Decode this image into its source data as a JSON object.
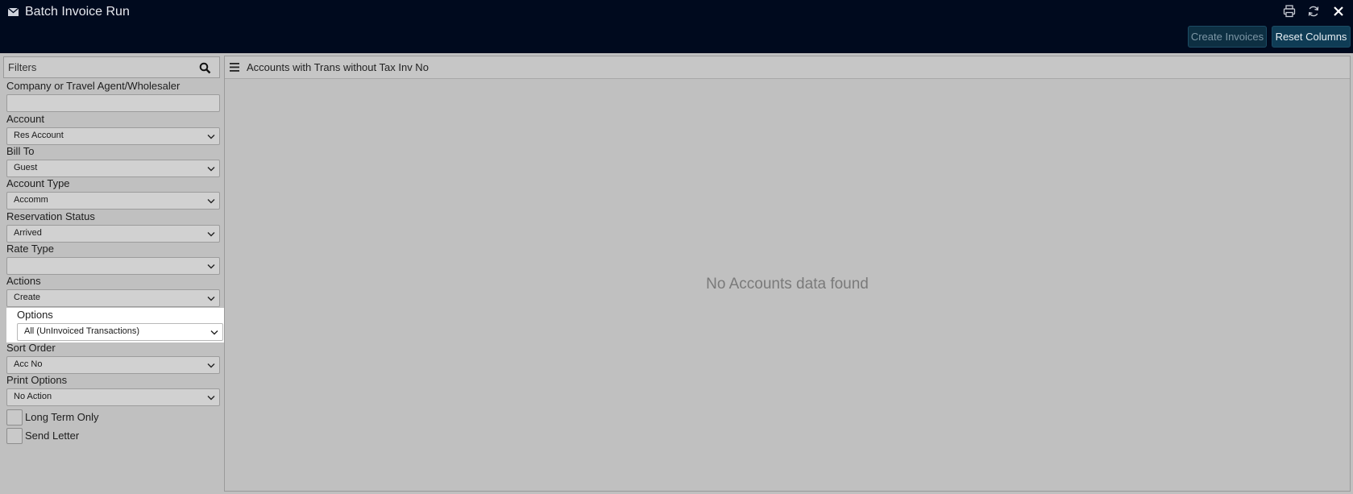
{
  "window": {
    "title": "Batch Invoice Run"
  },
  "toolbar": {
    "create_label": "Create Invoices",
    "reset_label": "Reset Columns"
  },
  "filters": {
    "title": "Filters",
    "company": {
      "label": "Company or Travel Agent/Wholesaler",
      "value": ""
    },
    "account": {
      "label": "Account",
      "value": "Res Account"
    },
    "bill_to": {
      "label": "Bill To",
      "value": "Guest"
    },
    "account_type": {
      "label": "Account Type",
      "value": "Accomm"
    },
    "reservation_status": {
      "label": "Reservation Status",
      "value": "Arrived"
    },
    "rate_type": {
      "label": "Rate Type",
      "value": ""
    },
    "actions": {
      "label": "Actions",
      "value": "Create"
    },
    "options": {
      "label": "Options",
      "value": "All (UnInvoiced Transactions)"
    },
    "sort_order": {
      "label": "Sort Order",
      "value": "Acc No"
    },
    "print_options": {
      "label": "Print Options",
      "value": "No Action"
    },
    "long_term_only": {
      "label": "Long Term Only",
      "checked": false
    },
    "send_letter": {
      "label": "Send Letter",
      "checked": false
    }
  },
  "main": {
    "title": "Accounts with Trans without Tax Inv No",
    "empty_message": "No Accounts data found"
  },
  "colors": {
    "titlebar_bg": "#000a1e",
    "panel_bg": "#c0c0c0",
    "button_bg": "#0f3c55",
    "highlight_bg": "#ffffff"
  }
}
